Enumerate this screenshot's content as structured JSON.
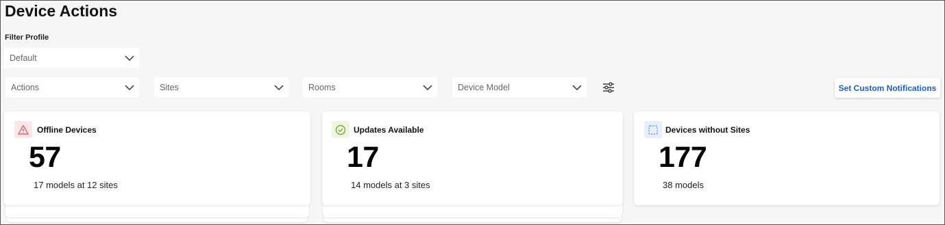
{
  "page": {
    "title": "Device Actions"
  },
  "filter_profile": {
    "label": "Filter Profile",
    "value": "Default"
  },
  "filters": {
    "actions": "Actions",
    "sites": "Sites",
    "rooms": "Rooms",
    "device_model": "Device Model"
  },
  "toolbar": {
    "custom_notifications_label": "Set Custom Notifications"
  },
  "cards": [
    {
      "title": "Offline Devices",
      "count": "57",
      "subtitle": "17 models at 12 sites",
      "icon": "warning-icon",
      "icon_color": "#e0455b",
      "icon_bg": "#fde6ea"
    },
    {
      "title": "Updates Available",
      "count": "17",
      "subtitle": "14 models at 3 sites",
      "icon": "check-circle-icon",
      "icon_color": "#6a9a2a",
      "icon_bg": "#eef6dd"
    },
    {
      "title": "Devices without Sites",
      "count": "177",
      "subtitle": "38 models",
      "icon": "dashed-square-icon",
      "icon_color": "#4f86d8",
      "icon_bg": "#e6effb"
    }
  ],
  "colors": {
    "accent": "#1a5fc8",
    "background": "#f6f6f7"
  }
}
